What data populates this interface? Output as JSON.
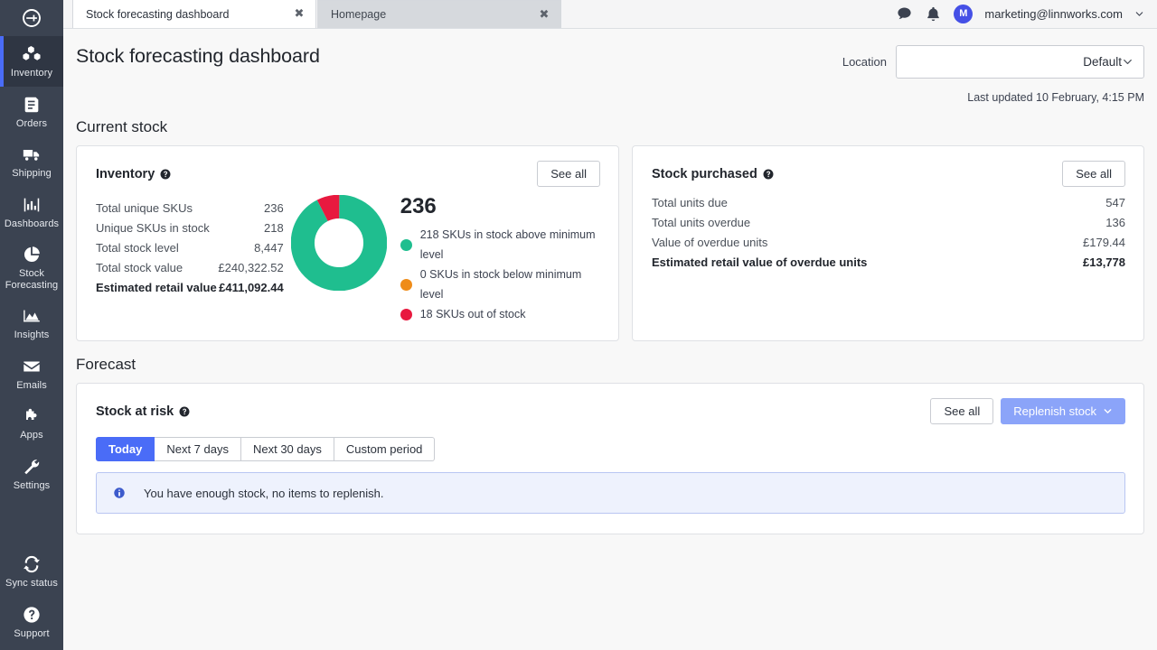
{
  "browser": {
    "tabs": [
      {
        "title": "Stock forecasting dashboard",
        "active": true,
        "close": "✖"
      },
      {
        "title": "Homepage",
        "active": false,
        "close": "✖"
      }
    ],
    "chat_icon": "chat-bubble-icon",
    "bell_icon": "bell-icon",
    "avatar_initial": "M",
    "user_email": "marketing@linnworks.com"
  },
  "sidebar": {
    "logo": "linnworks-logo",
    "items": [
      {
        "label": "Inventory",
        "icon": "boxes-icon",
        "active": true
      },
      {
        "label": "Orders",
        "icon": "orders-icon",
        "active": false
      },
      {
        "label": "Shipping",
        "icon": "truck-icon",
        "active": false
      },
      {
        "label": "Dashboards",
        "icon": "bar-chart-icon",
        "active": false
      },
      {
        "label": "Stock Forecasting",
        "icon": "pie-chart-icon",
        "active": false
      },
      {
        "label": "Insights",
        "icon": "area-chart-icon",
        "active": false
      },
      {
        "label": "Emails",
        "icon": "envelope-icon",
        "active": false
      },
      {
        "label": "Apps",
        "icon": "puzzle-icon",
        "active": false
      },
      {
        "label": "Settings",
        "icon": "wrench-icon",
        "active": false
      }
    ],
    "bottom_items": [
      {
        "label": "Sync status",
        "icon": "sync-icon"
      },
      {
        "label": "Support",
        "icon": "question-circle-icon"
      }
    ]
  },
  "header": {
    "title": "Stock forecasting dashboard",
    "location_label": "Location",
    "location_value": "Default",
    "last_updated": "Last updated 10 February, 4:15 PM"
  },
  "current_stock": {
    "section_title": "Current stock",
    "inventory": {
      "title": "Inventory",
      "see_all": "See all",
      "rows": [
        {
          "label": "Total unique SKUs",
          "value": "236",
          "bold": false
        },
        {
          "label": "Unique SKUs in stock",
          "value": "218",
          "bold": false
        },
        {
          "label": "Total stock level",
          "value": "8,447",
          "bold": false
        },
        {
          "label": "Total stock value",
          "value": "£240,322.52",
          "bold": false
        },
        {
          "label": "Estimated retail value",
          "value": "£411,092.44",
          "bold": true
        }
      ],
      "donut_total": "236",
      "legend": [
        {
          "text": "218 SKUs in stock above minimum level",
          "color": "#1fbe8f"
        },
        {
          "text": "0 SKUs in stock below minimum level",
          "color": "#ef8c19"
        },
        {
          "text": "18 SKUs out of stock",
          "color": "#e8193f"
        }
      ]
    },
    "stock_purchased": {
      "title": "Stock purchased",
      "see_all": "See all",
      "rows": [
        {
          "label": "Total units due",
          "value": "547",
          "bold": false
        },
        {
          "label": "Total units overdue",
          "value": "136",
          "bold": false
        },
        {
          "label": "Value of overdue units",
          "value": "£179.44",
          "bold": false
        },
        {
          "label": "Estimated retail value of overdue units",
          "value": "£13,778",
          "bold": true
        }
      ]
    }
  },
  "forecast": {
    "section_title": "Forecast",
    "card_title": "Stock at risk",
    "see_all": "See all",
    "replenish": "Replenish stock",
    "tabs": [
      {
        "label": "Today",
        "active": true
      },
      {
        "label": "Next 7 days",
        "active": false
      },
      {
        "label": "Next 30 days",
        "active": false
      },
      {
        "label": "Custom period",
        "active": false
      }
    ],
    "alert": "You have enough stock, no items to replenish."
  },
  "chart_data": {
    "type": "pie",
    "title": "Inventory SKU status",
    "total": 236,
    "categories": [
      "218 SKUs in stock above minimum level",
      "0 SKUs in stock below minimum level",
      "18 SKUs out of stock"
    ],
    "values": [
      218,
      0,
      18
    ],
    "colors": [
      "#1fbe8f",
      "#ef8c19",
      "#e8193f"
    ],
    "legend_position": "right",
    "donut": true
  }
}
